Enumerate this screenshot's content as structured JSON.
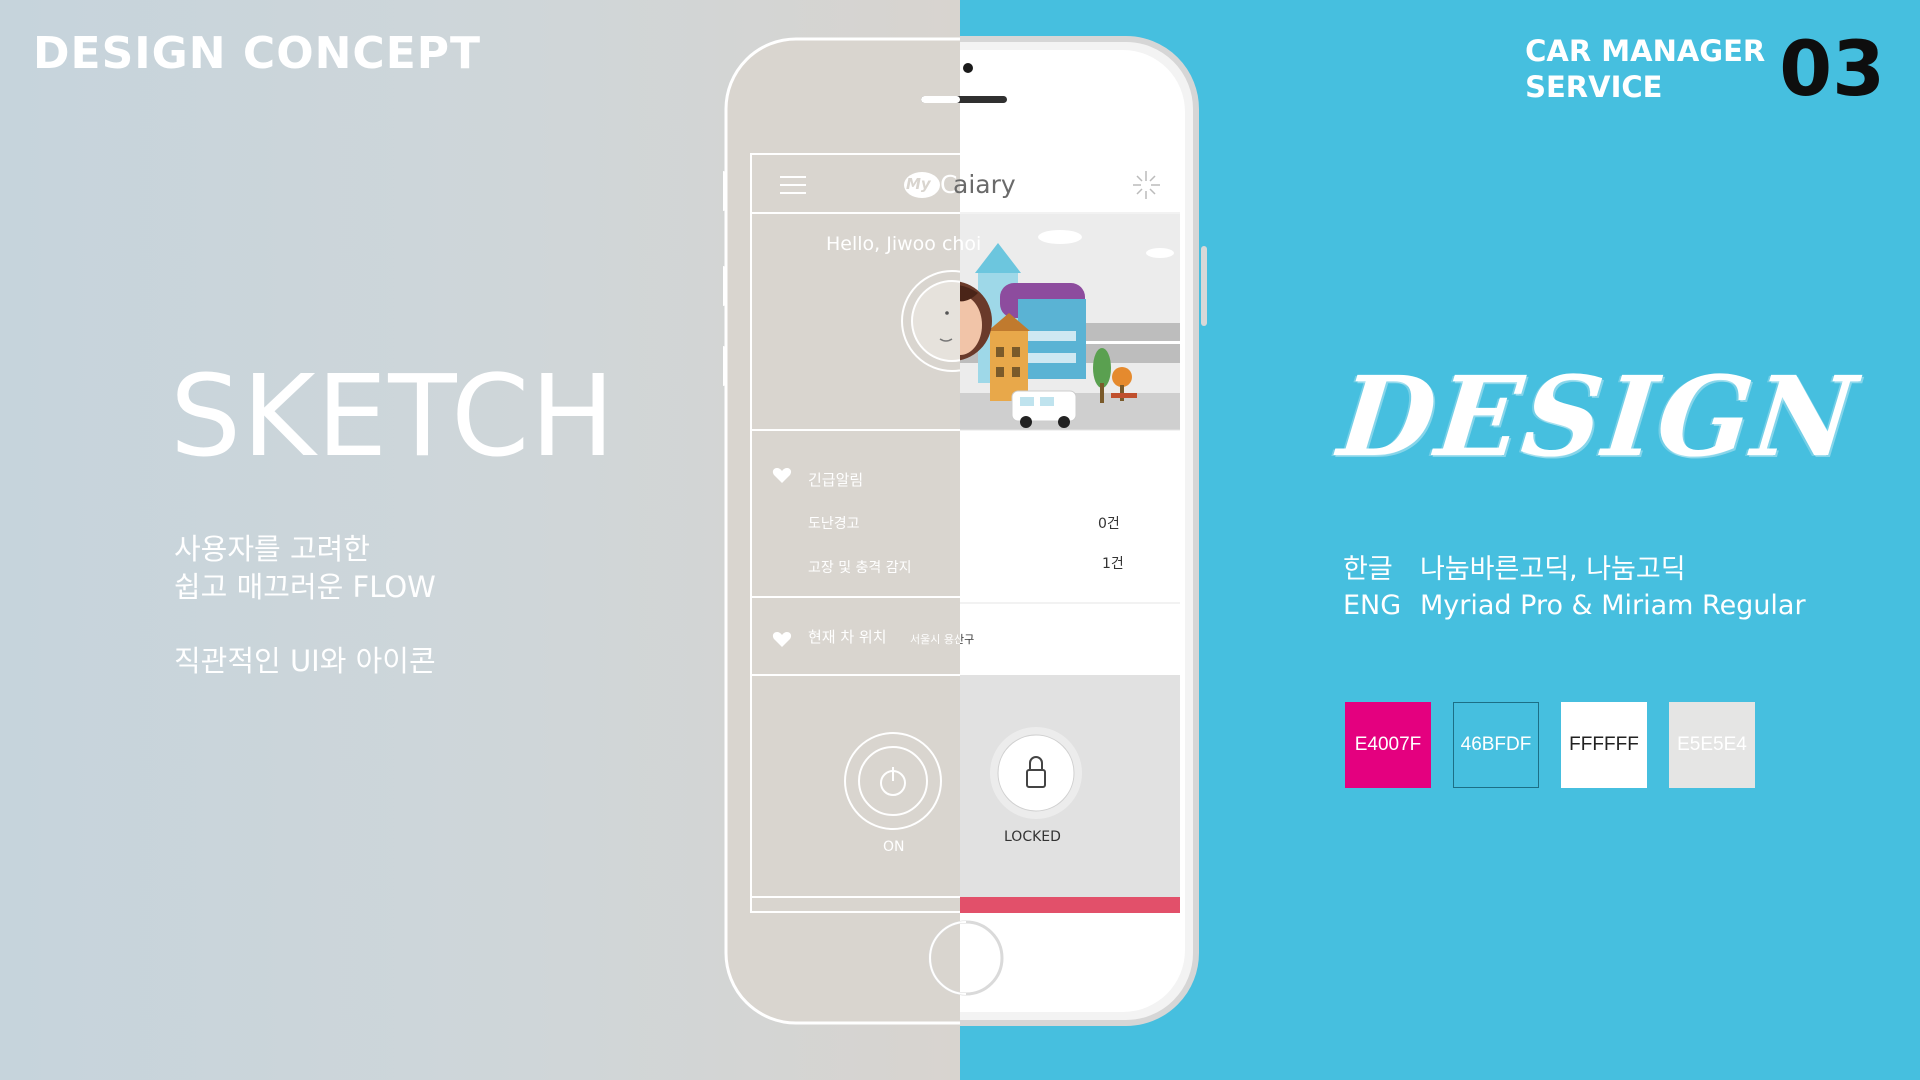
{
  "header": {
    "concept": "DESIGN CONCEPT",
    "service_line1": "CAR MANAGER",
    "service_line2": "SERVICE",
    "page_number": "03"
  },
  "sketch": {
    "title": "SKETCH",
    "line1": "사용자를 고려한",
    "line2": "쉽고 매끄러운 FLOW",
    "line3": "직관적인 UI와 아이콘"
  },
  "design": {
    "title": "DESIGN",
    "korean_label": "한글",
    "korean_fonts": "나눔바른고딕, 나눔고딕",
    "eng_label": "ENG",
    "eng_fonts": "Myriad Pro & Miriam Regular"
  },
  "palette": [
    {
      "hex": "E4007F",
      "color": "#E4007F",
      "text": "#ffffff"
    },
    {
      "hex": "46BFDF",
      "color": "#46BFDF",
      "text": "#ffffff"
    },
    {
      "hex": "FFFFFF",
      "color": "#FFFFFF",
      "text": "#222222"
    },
    {
      "hex": "E5E5E4",
      "color": "#E5E5E4",
      "text": "#ffffff"
    }
  ],
  "app": {
    "logo_my": "My",
    "logo_name": "Caiary",
    "greeting": "Hello, Jiwoo choi",
    "alert_title": "긴급알림",
    "alert1_label": "도난경고",
    "alert1_value": "0건",
    "alert2_label": "고장 및 충격 감지",
    "alert2_value": "1건",
    "location_title": "현재 차 위치",
    "location_value": "서울시 용산구",
    "power_label": "ON",
    "lock_label": "LOCKED"
  }
}
